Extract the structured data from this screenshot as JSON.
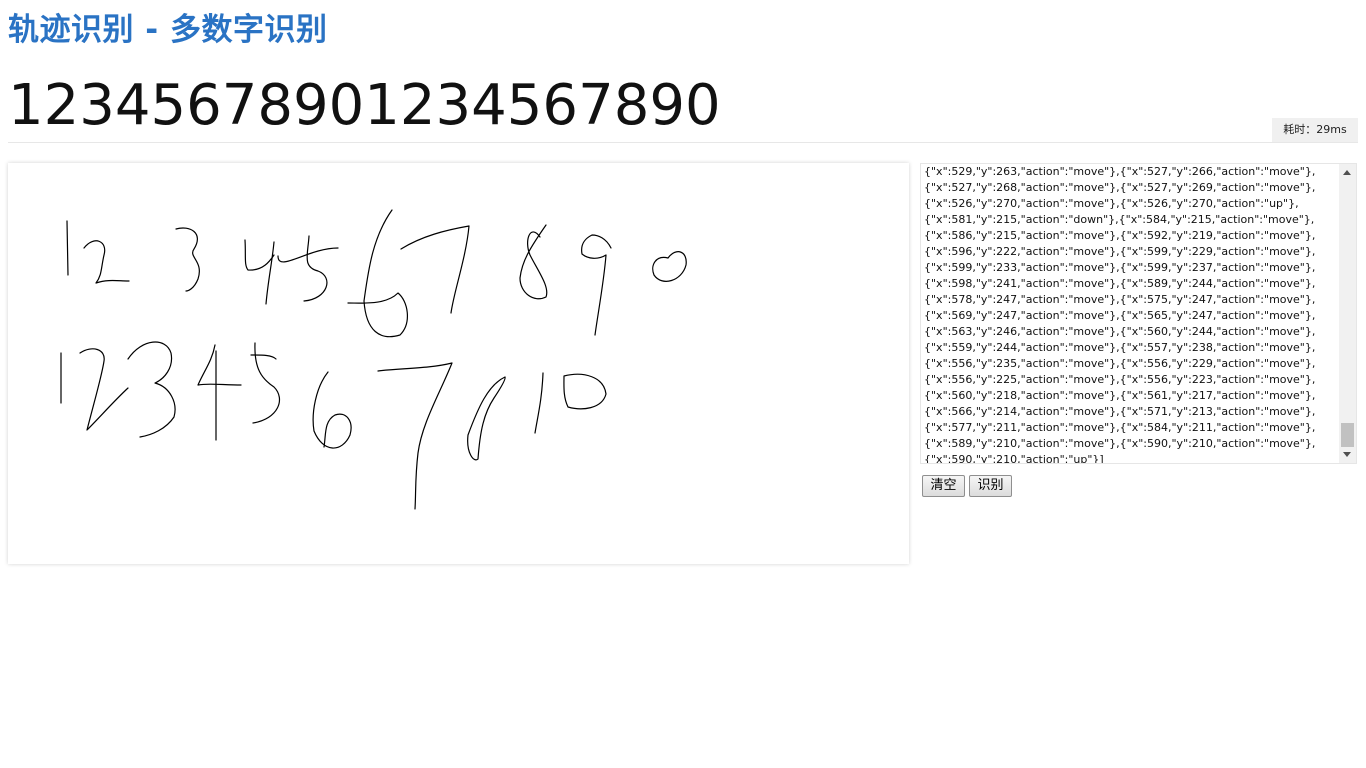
{
  "header": {
    "title": "轨迹识别 - 多数字识别"
  },
  "result": {
    "text": "12345678901234567890",
    "elapsed": "耗时：29ms"
  },
  "points_textarea": {
    "value": "{\"x\":529,\"y\":263,\"action\":\"move\"},{\"x\":527,\"y\":266,\"action\":\"move\"},\n{\"x\":527,\"y\":268,\"action\":\"move\"},{\"x\":527,\"y\":269,\"action\":\"move\"},\n{\"x\":526,\"y\":270,\"action\":\"move\"},{\"x\":526,\"y\":270,\"action\":\"up\"},\n{\"x\":581,\"y\":215,\"action\":\"down\"},{\"x\":584,\"y\":215,\"action\":\"move\"},\n{\"x\":586,\"y\":215,\"action\":\"move\"},{\"x\":592,\"y\":219,\"action\":\"move\"},\n{\"x\":596,\"y\":222,\"action\":\"move\"},{\"x\":599,\"y\":229,\"action\":\"move\"},\n{\"x\":599,\"y\":233,\"action\":\"move\"},{\"x\":599,\"y\":237,\"action\":\"move\"},\n{\"x\":598,\"y\":241,\"action\":\"move\"},{\"x\":589,\"y\":244,\"action\":\"move\"},\n{\"x\":578,\"y\":247,\"action\":\"move\"},{\"x\":575,\"y\":247,\"action\":\"move\"},\n{\"x\":569,\"y\":247,\"action\":\"move\"},{\"x\":565,\"y\":247,\"action\":\"move\"},\n{\"x\":563,\"y\":246,\"action\":\"move\"},{\"x\":560,\"y\":244,\"action\":\"move\"},\n{\"x\":559,\"y\":244,\"action\":\"move\"},{\"x\":557,\"y\":238,\"action\":\"move\"},\n{\"x\":556,\"y\":235,\"action\":\"move\"},{\"x\":556,\"y\":229,\"action\":\"move\"},\n{\"x\":556,\"y\":225,\"action\":\"move\"},{\"x\":556,\"y\":223,\"action\":\"move\"},\n{\"x\":560,\"y\":218,\"action\":\"move\"},{\"x\":561,\"y\":217,\"action\":\"move\"},\n{\"x\":566,\"y\":214,\"action\":\"move\"},{\"x\":571,\"y\":213,\"action\":\"move\"},\n{\"x\":577,\"y\":211,\"action\":\"move\"},{\"x\":584,\"y\":211,\"action\":\"move\"},\n{\"x\":589,\"y\":210,\"action\":\"move\"},{\"x\":590,\"y\":210,\"action\":\"move\"},\n{\"x\":590,\"y\":210,\"action\":\"up\"}]"
  },
  "buttons": {
    "clear": "清空",
    "recognize": "识别"
  }
}
